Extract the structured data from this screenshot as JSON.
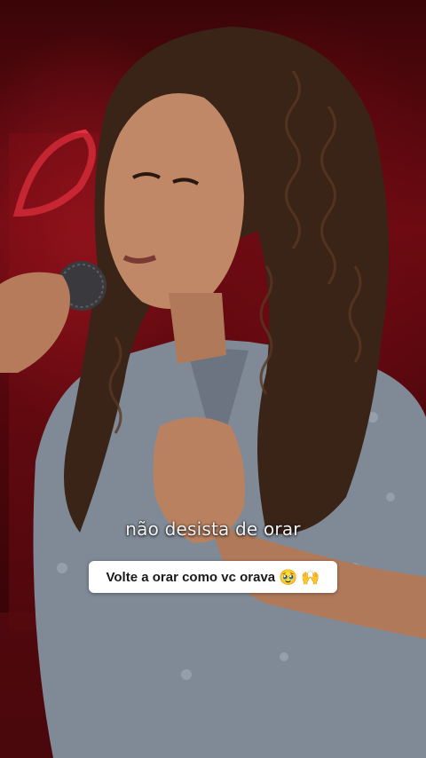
{
  "caption": {
    "text": "não desista de orar"
  },
  "sticker": {
    "text": "Volte a orar como vc orava",
    "emoji_1": "🥹",
    "emoji_2": "🙌"
  },
  "colors": {
    "background_red": "#6d0a12",
    "shirt_blue": "#7f8a96",
    "hair_brown": "#3a2418",
    "skin": "#c08866",
    "sticker_bg": "#ffffff"
  }
}
